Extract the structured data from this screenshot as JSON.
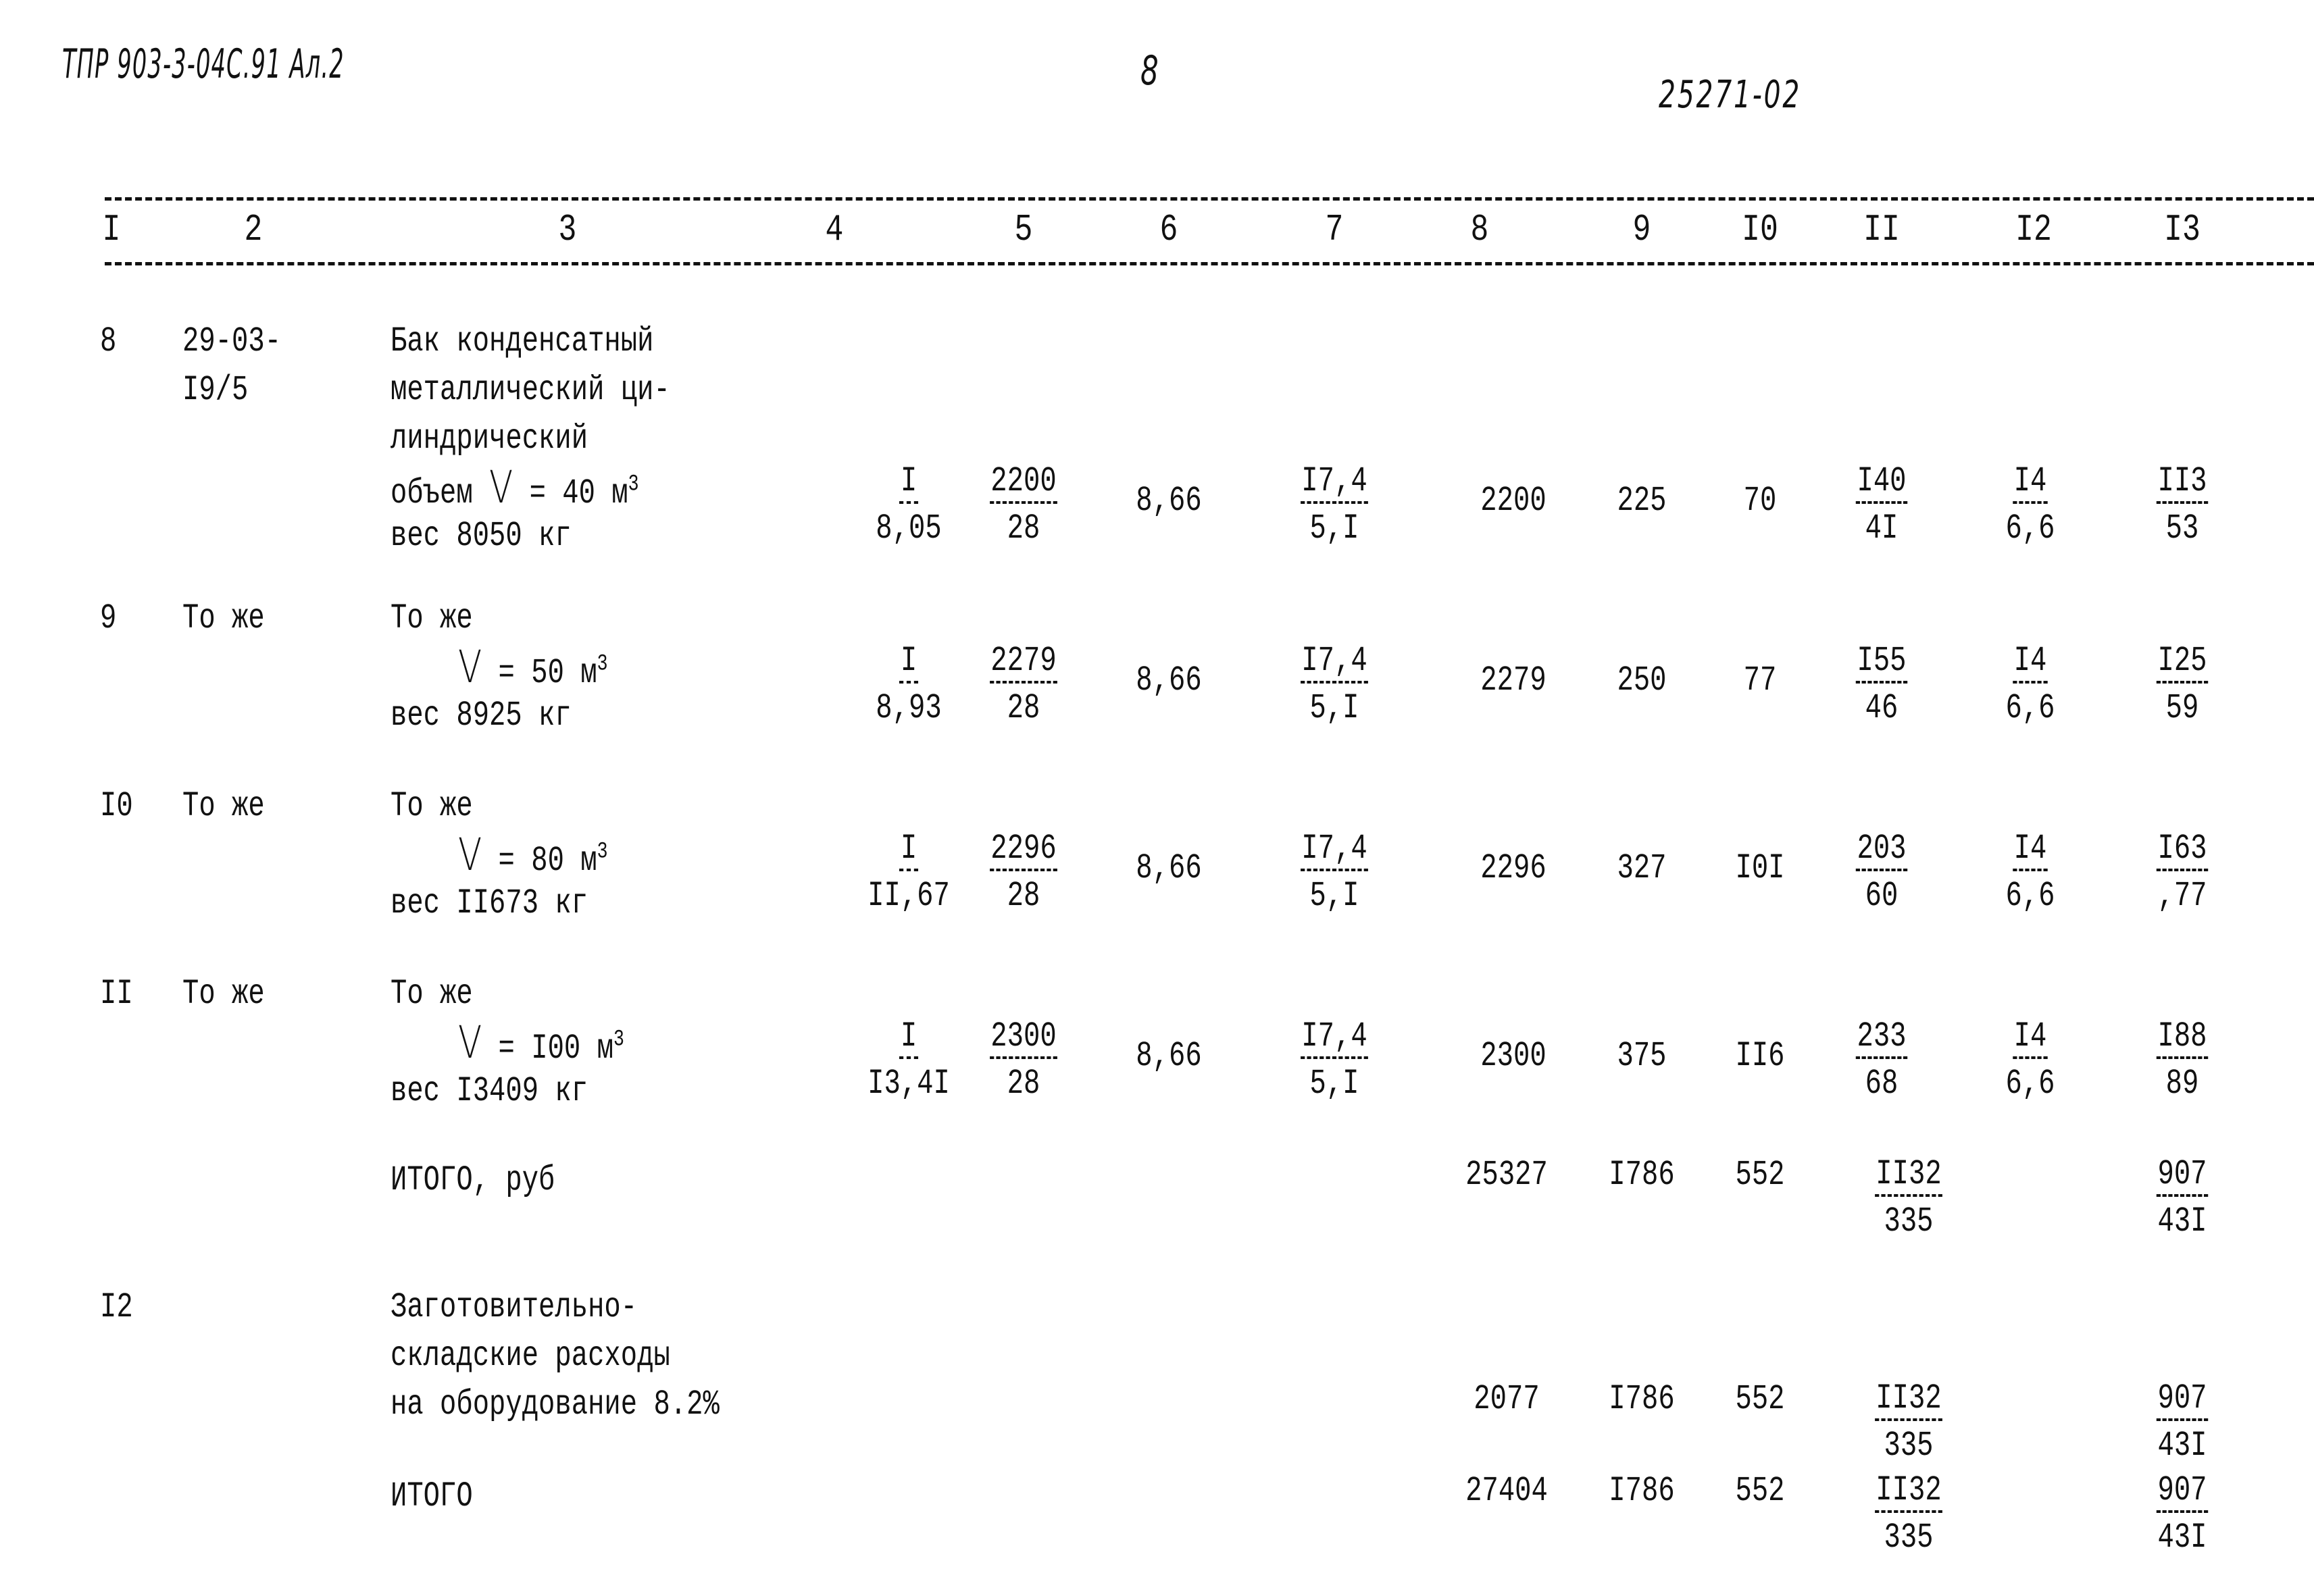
{
  "header": {
    "doc_code": "ТПР 903-3-04С.91 Ал.2",
    "page_number": "8",
    "doc_number": "25271-02"
  },
  "columns": [
    "I",
    "2",
    "3",
    "4",
    "5",
    "6",
    "7",
    "8",
    "9",
    "I0",
    "II",
    "I2",
    "I3"
  ],
  "rows": [
    {
      "no": "8",
      "code": [
        "29-03-",
        "I9/5"
      ],
      "description": [
        "Бак конденсатный",
        "металлический ци-",
        "линдрический"
      ],
      "volume_prefix": "объем",
      "volume_sym": "V",
      "volume_value": "= 40 м",
      "volume_exp": "3",
      "weight": "вес 8050 кг",
      "c4": {
        "num": "I",
        "den": "8,05"
      },
      "c5": {
        "num": "2200",
        "den": "28"
      },
      "c6": "8,66",
      "c7": {
        "num": "I7,4",
        "den": "5,I"
      },
      "c8": "2200",
      "c9": "225",
      "c10": "70",
      "c11": {
        "num": "I40",
        "den": "4I"
      },
      "c12": {
        "num": "I4",
        "den": "6,6"
      },
      "c13": {
        "num": "II3",
        "den": "53"
      }
    },
    {
      "no": "9",
      "code": [
        "То же"
      ],
      "description": [
        "То же"
      ],
      "volume_prefix": "",
      "volume_sym": "V",
      "volume_value": "= 50 м",
      "volume_exp": "3",
      "weight": "вес 8925 кг",
      "c4": {
        "num": "I",
        "den": "8,93"
      },
      "c5": {
        "num": "2279",
        "den": "28"
      },
      "c6": "8,66",
      "c7": {
        "num": "I7,4",
        "den": "5,I"
      },
      "c8": "2279",
      "c9": "250",
      "c10": "77",
      "c11": {
        "num": "I55",
        "den": "46"
      },
      "c12": {
        "num": "I4",
        "den": "6,6"
      },
      "c13": {
        "num": "I25",
        "den": "59"
      }
    },
    {
      "no": "I0",
      "code": [
        "То же"
      ],
      "description": [
        "То же"
      ],
      "volume_prefix": "",
      "volume_sym": "V",
      "volume_value": "= 80 м",
      "volume_exp": "3",
      "weight": "вес II673 кг",
      "c4": {
        "num": "I",
        "den": "II,67"
      },
      "c5": {
        "num": "2296",
        "den": "28"
      },
      "c6": "8,66",
      "c7": {
        "num": "I7,4",
        "den": "5,I"
      },
      "c8": "2296",
      "c9": "327",
      "c10": "I0I",
      "c11": {
        "num": "203",
        "den": "60"
      },
      "c12": {
        "num": "I4",
        "den": "6,6"
      },
      "c13": {
        "num": "I63",
        "den": ",77"
      }
    },
    {
      "no": "II",
      "code": [
        "То же"
      ],
      "description": [
        "То же"
      ],
      "volume_prefix": "",
      "volume_sym": "V",
      "volume_value": "= I00 м",
      "volume_exp": "3",
      "weight": "вес I3409 кг",
      "c4": {
        "num": "I",
        "den": "I3,4I"
      },
      "c5": {
        "num": "2300",
        "den": "28"
      },
      "c6": "8,66",
      "c7": {
        "num": "I7,4",
        "den": "5,I"
      },
      "c8": "2300",
      "c9": "375",
      "c10": "II6",
      "c11": {
        "num": "233",
        "den": "68"
      },
      "c12": {
        "num": "I4",
        "den": "6,6"
      },
      "c13": {
        "num": "I88",
        "den": "89"
      }
    }
  ],
  "subtotal": {
    "label": "ИТОГО, руб",
    "c8": "25327",
    "c9": "I786",
    "c10": "552",
    "c11": {
      "num": "II32",
      "den": "335"
    },
    "c13": {
      "num": "907",
      "den": "43I"
    }
  },
  "overhead": {
    "no": "I2",
    "description": [
      "Заготовительно-",
      "складские расходы",
      "на оборудование 8.2%"
    ],
    "c8": "2077",
    "c9": "I786",
    "c10": "552",
    "c11": {
      "num": "II32",
      "den": "335"
    },
    "c13": {
      "num": "907",
      "den": "43I"
    }
  },
  "total": {
    "label": "ИТОГО",
    "c8": "27404",
    "c9": "I786",
    "c10": "552",
    "c11": {
      "num": "II32",
      "den": "335"
    },
    "c13": {
      "num": "907",
      "den": "43I"
    }
  }
}
